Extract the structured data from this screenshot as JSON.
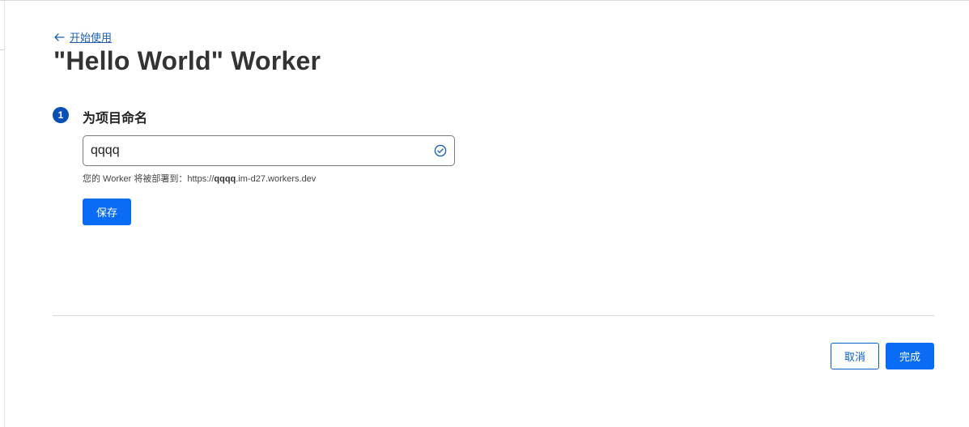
{
  "header": {
    "back_link_label": "开始使用",
    "back_icon": "arrow-left-icon",
    "title": "\"Hello World\" Worker"
  },
  "step": {
    "number": "1",
    "title": "为项目命名",
    "input_value": "qqqq",
    "valid_icon": "check-circle-icon",
    "hint_prefix": "您的 Worker 将被部署到：https://",
    "hint_name": "qqqq",
    "hint_suffix": ".im-d27.workers.dev",
    "save_label": "保存"
  },
  "footer": {
    "cancel_label": "取消",
    "done_label": "完成"
  },
  "colors": {
    "accent": "#0a6cf5",
    "badge": "#0a4fb4",
    "link": "#1f5fb3"
  }
}
